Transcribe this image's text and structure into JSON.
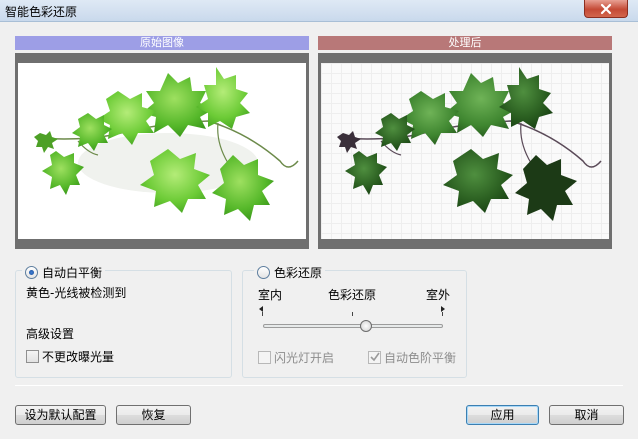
{
  "window": {
    "title": "智能色彩还原"
  },
  "panels": {
    "original": {
      "header": "原始图像"
    },
    "processed": {
      "header": "处理后"
    }
  },
  "white_balance": {
    "radio_label": "自动白平衡",
    "checked": true,
    "status": "黄色-光线被检测到",
    "advanced_label": "高级设置",
    "keep_exposure": {
      "label": "不更改曝光量",
      "checked": false
    }
  },
  "color_restore": {
    "radio_label": "色彩还原",
    "checked": false,
    "left_label": "室内",
    "center_label": "色彩还原",
    "right_label": "室外",
    "slider_value": 0.57,
    "flash": {
      "label": "闪光灯开启",
      "checked": false,
      "disabled": true
    },
    "auto_levels": {
      "label": "自动色阶平衡",
      "checked": true,
      "disabled": true
    }
  },
  "buttons": {
    "set_default": "设为默认配置",
    "restore": "恢复",
    "apply": "应用",
    "cancel": "取消"
  },
  "colors": {
    "original_header": "#9d9ee6",
    "processed_header": "#b87878"
  }
}
